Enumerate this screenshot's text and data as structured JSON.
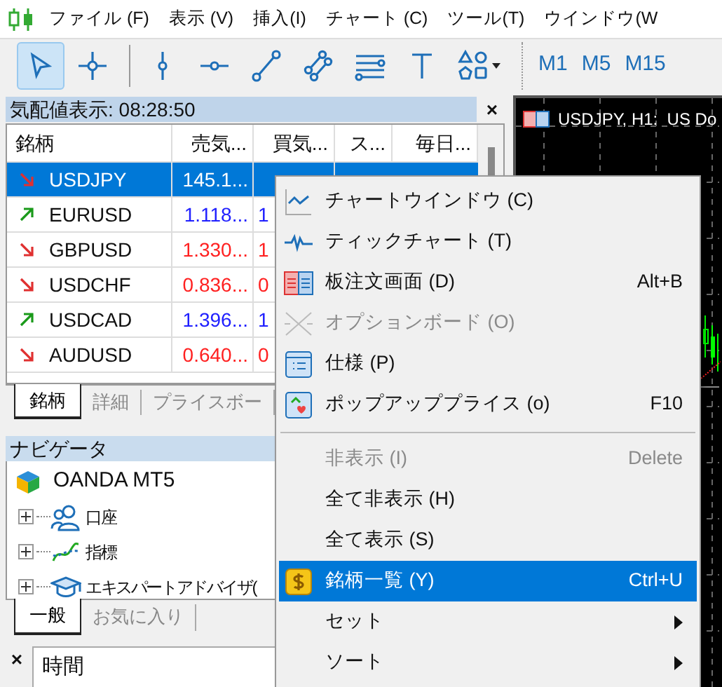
{
  "menu_bar": [
    "ファイル (F)",
    "表示 (V)",
    "挿入(I)",
    "チャート (C)",
    "ツール(T)",
    "ウインドウ(W"
  ],
  "toolbar": {
    "tools": [
      {
        "selected": true
      },
      {
        "selected": false
      },
      {
        "selected": false
      },
      {
        "selected": false
      },
      {
        "selected": false
      },
      {
        "selected": false
      },
      {
        "selected": false
      },
      {
        "selected": false
      },
      {
        "selected": false
      }
    ],
    "timeframes": [
      "M1",
      "M5",
      "M15"
    ]
  },
  "market_watch": {
    "title": "気配値表示: 08:28:50",
    "close": "×",
    "columns": [
      "銘柄",
      "売気...",
      "買気...",
      "ス...",
      "毎日..."
    ],
    "rows": [
      {
        "symbol": "USDJPY",
        "rising": false,
        "selected": true,
        "bid": "145.1..."
      },
      {
        "symbol": "EURUSD",
        "rising": true,
        "selected": false,
        "bid": "1.118...",
        "ask": "1"
      },
      {
        "symbol": "GBPUSD",
        "rising": false,
        "selected": false,
        "bid": "1.330...",
        "ask": "1"
      },
      {
        "symbol": "USDCHF",
        "rising": false,
        "selected": false,
        "bid": "0.836...",
        "ask": "0"
      },
      {
        "symbol": "USDCAD",
        "rising": true,
        "selected": false,
        "bid": "1.396...",
        "ask": "1"
      },
      {
        "symbol": "AUDUSD",
        "rising": false,
        "selected": false,
        "bid": "0.640...",
        "ask": "0"
      }
    ],
    "tabs": [
      {
        "label": "銘柄",
        "selected": true
      },
      {
        "label": "詳細",
        "selected": false
      },
      {
        "label": "プライスボー",
        "selected": false
      }
    ]
  },
  "navigator": {
    "title": "ナビゲータ",
    "tree": [
      {
        "label": "OANDA MT5",
        "children": [
          {
            "label": "口座",
            "expanded": false
          },
          {
            "label": "指標",
            "expanded": false
          },
          {
            "label": "エキスパートアドバイザ(",
            "expanded": false
          }
        ]
      }
    ],
    "tabs": [
      {
        "label": "一般",
        "selected": true
      },
      {
        "label": "お気に入り",
        "selected": false
      }
    ]
  },
  "bottom_panel": {
    "close": "×",
    "column": "時間"
  },
  "chart": {
    "title": "USDJPY, H1:  US Do"
  },
  "context_menu": [
    {
      "kind": "item",
      "label": "チャートウインドウ (C)",
      "disabled": false,
      "selected": false
    },
    {
      "kind": "item",
      "label": "ティックチャート (T)",
      "disabled": false,
      "selected": false
    },
    {
      "kind": "item",
      "label": "板注文画面 (D)",
      "shortcut": "Alt+B",
      "disabled": false,
      "selected": false
    },
    {
      "kind": "item",
      "label": "オプションボード (O)",
      "disabled": true,
      "selected": false
    },
    {
      "kind": "item",
      "label": "仕様 (P)",
      "disabled": false,
      "selected": false
    },
    {
      "kind": "item",
      "label": "ポップアッププライス (o)",
      "shortcut": "F10",
      "disabled": false,
      "selected": false
    },
    {
      "kind": "separator"
    },
    {
      "kind": "item",
      "label": "非表示 (I)",
      "shortcut": "Delete",
      "disabled": true,
      "selected": false
    },
    {
      "kind": "item",
      "label": "全て非表示 (H)",
      "disabled": false,
      "selected": false
    },
    {
      "kind": "item",
      "label": "全て表示 (S)",
      "disabled": false,
      "selected": false
    },
    {
      "kind": "item",
      "label": "銘柄一覧 (Y)",
      "shortcut": "Ctrl+U",
      "disabled": false,
      "selected": true
    },
    {
      "kind": "item",
      "label": "セット",
      "submenu": true,
      "disabled": false,
      "selected": false
    },
    {
      "kind": "item",
      "label": "ソート",
      "submenu": true,
      "disabled": false,
      "selected": false
    }
  ]
}
